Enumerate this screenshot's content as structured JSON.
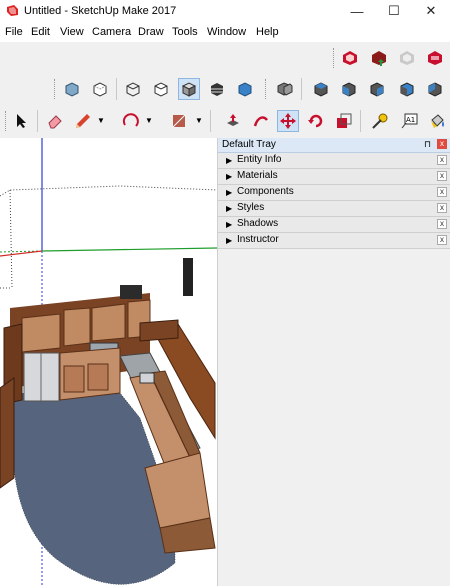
{
  "window": {
    "title": "Untitled - SketchUp Make 2017",
    "controls": {
      "minimize": "—",
      "maximize": "☐",
      "close": "✕"
    }
  },
  "menu": [
    "File",
    "Edit",
    "View",
    "Camera",
    "Draw",
    "Tools",
    "Window",
    "Help"
  ],
  "toolbars": {
    "row1": [
      "add-location-icon",
      "upload-model-icon",
      "share-component-icon",
      "extension-warehouse-icon"
    ],
    "row2": [
      "xray-style-icon",
      "back-edges-style-icon",
      "wireframe-style-icon",
      "hidden-line-style-icon",
      "shaded-style-icon",
      "shaded-textures-style-icon",
      "monochrome-style-icon",
      "iso-view-icon",
      "top-view-icon",
      "front-view-icon",
      "right-view-icon",
      "back-view-icon",
      "left-view-icon"
    ],
    "row3": [
      "select-icon",
      "eraser-icon",
      "pencil-icon",
      "arc-icon",
      "rectangle-icon",
      "push-pull-icon",
      "follow-me-icon",
      "move-icon",
      "rotate-icon",
      "scale-icon",
      "tape-measure-icon",
      "text-icon",
      "paint-bucket-icon"
    ]
  },
  "tray": {
    "title": "Default Tray",
    "pin": "📌",
    "close": "x",
    "panels": [
      {
        "label": "Entity Info",
        "close": "x"
      },
      {
        "label": "Materials",
        "close": "x"
      },
      {
        "label": "Components",
        "close": "x"
      },
      {
        "label": "Styles",
        "close": "x"
      },
      {
        "label": "Shadows",
        "close": "x"
      },
      {
        "label": "Instructor",
        "close": "x"
      }
    ]
  },
  "colors": {
    "axis_red": "#d12b2b",
    "axis_green": "#1f9d2b",
    "axis_blue": "#2b3fd1",
    "cabinet": "#b8835a",
    "floor": "#56657d"
  }
}
